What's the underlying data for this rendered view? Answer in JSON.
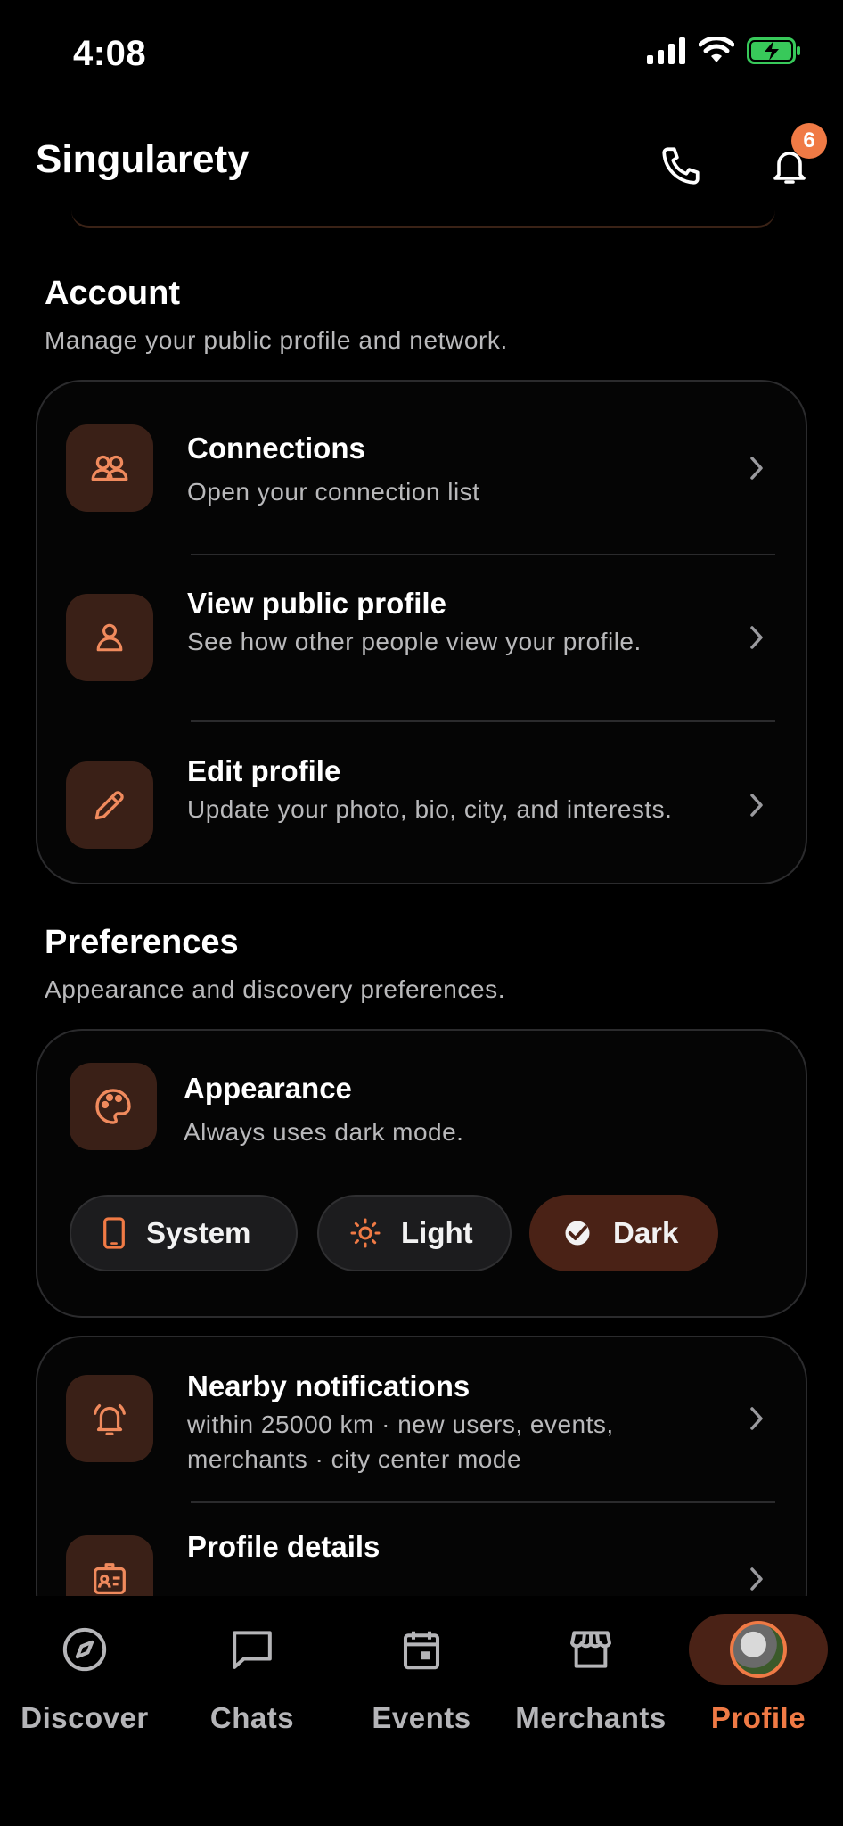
{
  "status_bar": {
    "time": "4:08"
  },
  "header": {
    "title": "Singularety",
    "notification_count": "6"
  },
  "account": {
    "title": "Account",
    "subtitle": "Manage your public profile and network.",
    "items": [
      {
        "title": "Connections",
        "subtitle": "Open your connection list",
        "icon": "people-icon"
      },
      {
        "title": "View public profile",
        "subtitle": "See how other people view your profile.",
        "icon": "person-icon"
      },
      {
        "title": "Edit profile",
        "subtitle": "Update your photo, bio, city, and interests.",
        "icon": "pencil-icon"
      }
    ]
  },
  "preferences": {
    "title": "Preferences",
    "subtitle": "Appearance and discovery preferences.",
    "appearance": {
      "title": "Appearance",
      "subtitle": "Always uses dark mode.",
      "options": [
        "System",
        "Light",
        "Dark"
      ],
      "selected": "Dark"
    },
    "items": [
      {
        "title": "Nearby notifications",
        "subtitle": "within 25000 km · new users, events, merchants · city center mode",
        "icon": "bell-ring-icon"
      },
      {
        "title": "Profile details",
        "subtitle": "",
        "icon": "badge-icon"
      }
    ]
  },
  "nav": {
    "items": [
      {
        "label": "Discover",
        "icon": "compass-icon"
      },
      {
        "label": "Chats",
        "icon": "chat-icon"
      },
      {
        "label": "Events",
        "icon": "calendar-icon"
      },
      {
        "label": "Merchants",
        "icon": "store-icon"
      },
      {
        "label": "Profile",
        "icon": "avatar"
      }
    ],
    "active": "Profile"
  },
  "colors": {
    "accent": "#f07a45",
    "icon_bg": "#3a2017",
    "active_bg": "#4a2216",
    "background": "#000000"
  }
}
